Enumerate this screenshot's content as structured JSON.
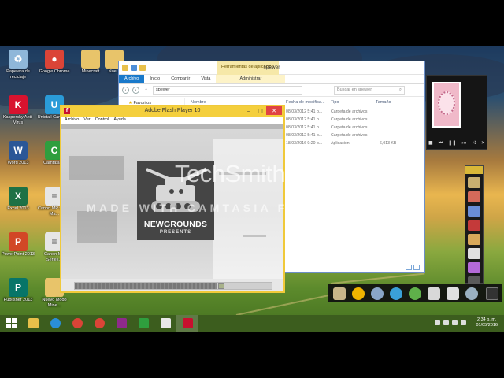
{
  "desktop_icons": [
    {
      "label": "Papelera de reciclaje",
      "icon": "recycle-bin-icon",
      "color": "#8fb7d9"
    },
    {
      "label": "Google Chrome",
      "icon": "chrome-icon",
      "color": "#db4437"
    },
    {
      "label": "Minecraft",
      "icon": "folder-icon",
      "color": "#e8c46a"
    },
    {
      "label": "Nue...",
      "icon": "folder-icon",
      "color": "#e8c46a"
    },
    {
      "label": "Kaspersky Anti-Virus",
      "icon": "kaspersky-icon",
      "color": "#d8132f"
    },
    {
      "label": "Unistall Camtasia",
      "icon": "uninstall-icon",
      "color": "#2a9bd8"
    },
    {
      "label": "Word 2013",
      "icon": "word-icon",
      "color": "#2b5797"
    },
    {
      "label": "Camtasia 8",
      "icon": "camtasia-icon",
      "color": "#2f9e3e"
    },
    {
      "label": "Excel 2013",
      "icon": "excel-icon",
      "color": "#1e7145"
    },
    {
      "label": "Canon MP series Ma...",
      "icon": "document-icon",
      "color": "#e6e6e6"
    },
    {
      "label": "PowerPoint 2013",
      "icon": "powerpoint-icon",
      "color": "#d24726"
    },
    {
      "label": "Canon MP Series...",
      "icon": "document-icon",
      "color": "#e6e6e6"
    },
    {
      "label": "Publisher 2013",
      "icon": "publisher-icon",
      "color": "#077568"
    },
    {
      "label": "Nuevo Modo Mine...",
      "icon": "folder-icon",
      "color": "#e8c46a"
    }
  ],
  "explorer": {
    "title": "spewer",
    "context_tab": "Herramientas de aplicación",
    "ribbon_tabs": [
      "Archivo",
      "Inicio",
      "Compartir",
      "Vista",
      "Administrar"
    ],
    "address": "spewer",
    "search_placeholder": "Buscar en spewer",
    "nav": {
      "favorites": "Favoritos"
    },
    "columns": [
      "Nombre",
      "Fecha de modifica...",
      "Tipo",
      "Tamaño"
    ],
    "rows": [
      {
        "date": "08/03/2012 5:41 p...",
        "type": "Carpeta de archivos",
        "size": ""
      },
      {
        "date": "08/03/2012 5:41 p...",
        "type": "Carpeta de archivos",
        "size": ""
      },
      {
        "date": "08/03/2012 5:41 p...",
        "type": "Carpeta de archivos",
        "size": ""
      },
      {
        "date": "08/03/2012 5:41 p...",
        "type": "Carpeta de archivos",
        "size": ""
      },
      {
        "date": "18/03/2016 9:20 p...",
        "type": "Aplicación",
        "size": "6,013 KB"
      }
    ]
  },
  "flash": {
    "title": "Adobe Flash Player 10",
    "menu": [
      "Archivo",
      "Ver",
      "Control",
      "Ayuda"
    ],
    "logo_text": "NEWGROUNDS",
    "logo_sub": "PRESENTS",
    "progress": 0.72
  },
  "watermark": {
    "brand": "TechSmith",
    "reg": "®",
    "line": "MADE WITH CAMTASIA FREE TRIAL"
  },
  "taskbar": {
    "time": "2:34 p. m.",
    "date": "01/05/2016",
    "apps": [
      {
        "icon": "file-explorer-icon",
        "color": "#e8c04a"
      },
      {
        "icon": "internet-explorer-icon",
        "color": "#2a8fd8"
      },
      {
        "icon": "chrome-icon",
        "color": "#db4437"
      },
      {
        "icon": "chrome-icon",
        "color": "#db4437"
      },
      {
        "icon": "winrar-icon",
        "color": "#8e2a8a"
      },
      {
        "icon": "camtasia-icon",
        "color": "#2f9e3e"
      },
      {
        "icon": "camtasia-recorder-icon",
        "color": "#e8e8e8"
      },
      {
        "icon": "flash-player-icon",
        "color": "#c8102e"
      }
    ]
  }
}
